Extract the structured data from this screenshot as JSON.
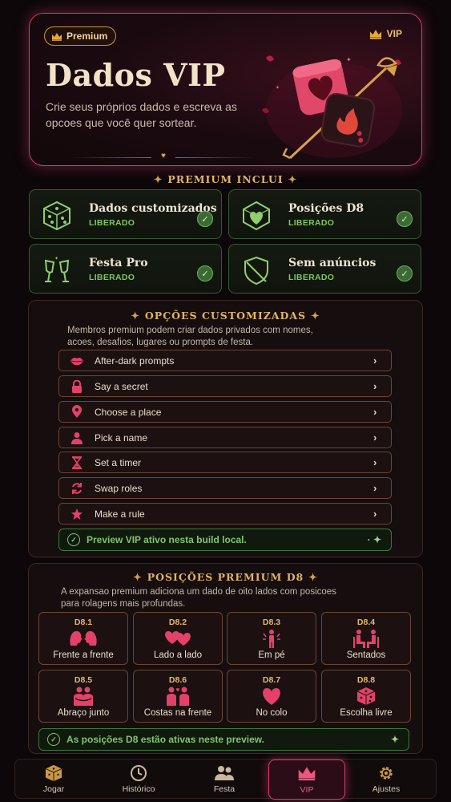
{
  "hero": {
    "badge_label": "Premium",
    "vip_label": "VIP",
    "title": "Dados VIP",
    "subtitle": "Crie seus próprios dados e escreva as opcoes que você quer sortear."
  },
  "premium_includes": {
    "header": "PREMIUM INCLUI",
    "features": [
      {
        "title": "Dados customizados",
        "status": "LIBERADO",
        "icon": "dice-icon"
      },
      {
        "title": "Posições D8",
        "status": "LIBERADO",
        "icon": "d8-heart-icon"
      },
      {
        "title": "Festa Pro",
        "status": "LIBERADO",
        "icon": "champagne-icon"
      },
      {
        "title": "Sem anúncios",
        "status": "LIBERADO",
        "icon": "no-ads-shield-icon"
      }
    ]
  },
  "custom_options": {
    "header": "OPÇÕES CUSTOMIZADAS",
    "description": "Membros premium podem criar dados privados com nomes, acoes, desafios, lugares ou prompts de festa.",
    "items": [
      {
        "label": "After-dark prompts",
        "icon": "lips-icon"
      },
      {
        "label": "Say a secret",
        "icon": "lock-icon"
      },
      {
        "label": "Choose a place",
        "icon": "location-pin-icon"
      },
      {
        "label": "Pick a name",
        "icon": "person-icon"
      },
      {
        "label": "Set a timer",
        "icon": "hourglass-icon"
      },
      {
        "label": "Swap roles",
        "icon": "swap-arrows-icon"
      },
      {
        "label": "Make a rule",
        "icon": "star-icon"
      }
    ],
    "preview_note": "Preview VIP ativo nesta build local."
  },
  "positions": {
    "header": "POSIÇÕES PREMIUM D8",
    "description": "A expansao premium adiciona um dado de oito lados com posicoes para rolagens mais profundas.",
    "items": [
      {
        "code": "D8.1",
        "label": "Frente a frente",
        "icon": "face-to-face-icon"
      },
      {
        "code": "D8.2",
        "label": "Lado a lado",
        "icon": "hearts-icon"
      },
      {
        "code": "D8.3",
        "label": "Em pé",
        "icon": "standing-icon"
      },
      {
        "code": "D8.4",
        "label": "Sentados",
        "icon": "seated-icon"
      },
      {
        "code": "D8.5",
        "label": "Abraço junto",
        "icon": "hug-icon"
      },
      {
        "code": "D8.6",
        "label": "Costas na frente",
        "icon": "back-to-front-icon"
      },
      {
        "code": "D8.7",
        "label": "No colo",
        "icon": "heart-icon"
      },
      {
        "code": "D8.8",
        "label": "Escolha livre",
        "icon": "dice-icon"
      }
    ],
    "active_note": "As posições D8 estão ativas neste preview."
  },
  "nav": {
    "items": [
      {
        "label": "Jogar",
        "icon": "dice-icon"
      },
      {
        "label": "Histórico",
        "icon": "clock-icon"
      },
      {
        "label": "Festa",
        "icon": "group-icon"
      },
      {
        "label": "VIP",
        "icon": "crown-icon",
        "active": true
      },
      {
        "label": "Ajustes",
        "icon": "gear-icon"
      }
    ]
  },
  "colors": {
    "accent_pink": "#d63a6a",
    "gold": "#e2b468",
    "success_green": "#7ec85a",
    "background": "#0d0709"
  }
}
